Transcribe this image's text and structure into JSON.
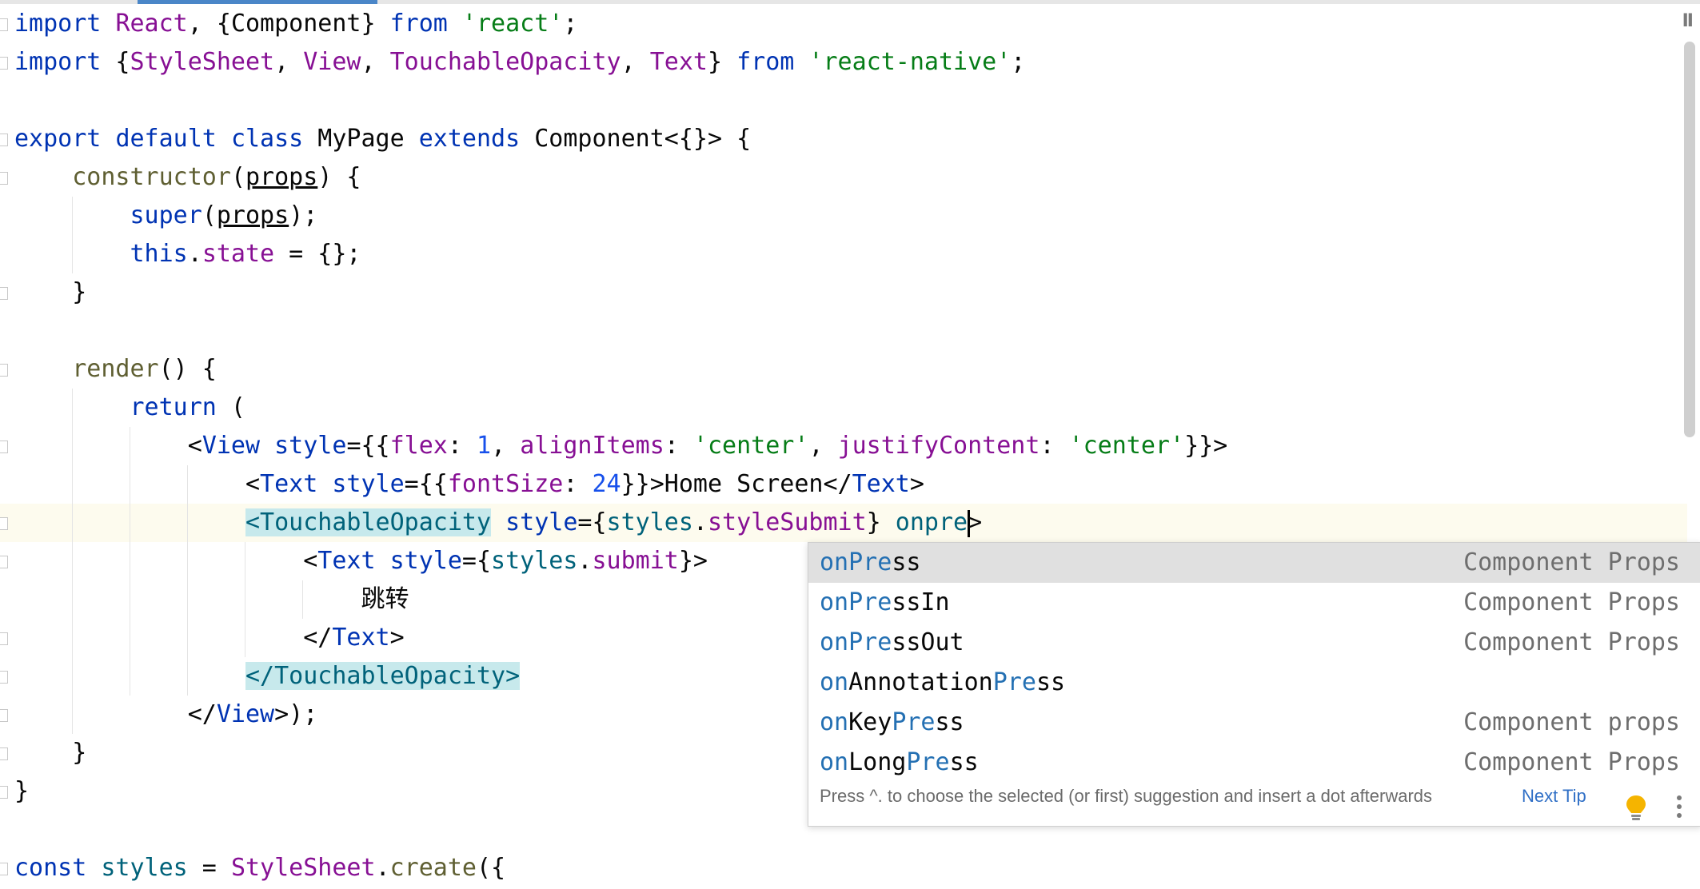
{
  "editor": {
    "lines": [
      {
        "tokens": [
          {
            "t": "import",
            "c": "kw"
          },
          {
            "t": " "
          },
          {
            "t": "React",
            "c": "prop"
          },
          {
            "t": ", {"
          },
          {
            "t": "Component"
          },
          {
            "t": "} "
          },
          {
            "t": "from",
            "c": "kw"
          },
          {
            "t": " "
          },
          {
            "t": "'react'",
            "c": "str"
          },
          {
            "t": ";"
          }
        ]
      },
      {
        "tokens": [
          {
            "t": "import",
            "c": "kw"
          },
          {
            "t": " {"
          },
          {
            "t": "StyleSheet",
            "c": "prop"
          },
          {
            "t": ", "
          },
          {
            "t": "View",
            "c": "prop"
          },
          {
            "t": ", "
          },
          {
            "t": "TouchableOpacity",
            "c": "prop"
          },
          {
            "t": ", "
          },
          {
            "t": "Text",
            "c": "prop"
          },
          {
            "t": "} "
          },
          {
            "t": "from",
            "c": "kw"
          },
          {
            "t": " "
          },
          {
            "t": "'react-native'",
            "c": "str"
          },
          {
            "t": ";"
          }
        ]
      },
      {
        "tokens": []
      },
      {
        "tokens": [
          {
            "t": "export",
            "c": "kw"
          },
          {
            "t": " "
          },
          {
            "t": "default",
            "c": "kw"
          },
          {
            "t": " "
          },
          {
            "t": "class",
            "c": "kw"
          },
          {
            "t": " MyPage "
          },
          {
            "t": "extends",
            "c": "kw"
          },
          {
            "t": " Component<{}> {"
          }
        ]
      },
      {
        "tokens": [
          {
            "t": "    "
          },
          {
            "t": "constructor",
            "c": "meth"
          },
          {
            "t": "("
          },
          {
            "t": "props",
            "c": "u"
          },
          {
            "t": ") {"
          }
        ]
      },
      {
        "tokens": [
          {
            "t": "        "
          },
          {
            "t": "super",
            "c": "kw"
          },
          {
            "t": "("
          },
          {
            "t": "props",
            "c": "u"
          },
          {
            "t": ");"
          }
        ]
      },
      {
        "tokens": [
          {
            "t": "        "
          },
          {
            "t": "this",
            "c": "kw"
          },
          {
            "t": "."
          },
          {
            "t": "state",
            "c": "prop"
          },
          {
            "t": " = {};"
          }
        ]
      },
      {
        "tokens": [
          {
            "t": "    }"
          }
        ]
      },
      {
        "tokens": []
      },
      {
        "tokens": [
          {
            "t": "    "
          },
          {
            "t": "render",
            "c": "meth"
          },
          {
            "t": "() {"
          }
        ]
      },
      {
        "tokens": [
          {
            "t": "        "
          },
          {
            "t": "return",
            "c": "kw"
          },
          {
            "t": " ("
          }
        ]
      },
      {
        "tokens": [
          {
            "t": "            <"
          },
          {
            "t": "View",
            "c": "tag"
          },
          {
            "t": " "
          },
          {
            "t": "style",
            "c": "tag"
          },
          {
            "t": "={{"
          },
          {
            "t": "flex",
            "c": "prop"
          },
          {
            "t": ": "
          },
          {
            "t": "1",
            "c": "num"
          },
          {
            "t": ", "
          },
          {
            "t": "alignItems",
            "c": "prop"
          },
          {
            "t": ": "
          },
          {
            "t": "'center'",
            "c": "str"
          },
          {
            "t": ", "
          },
          {
            "t": "justifyContent",
            "c": "prop"
          },
          {
            "t": ": "
          },
          {
            "t": "'center'",
            "c": "str"
          },
          {
            "t": "}}>"
          }
        ]
      },
      {
        "tokens": [
          {
            "t": "                <"
          },
          {
            "t": "Text",
            "c": "tag"
          },
          {
            "t": " "
          },
          {
            "t": "style",
            "c": "tag"
          },
          {
            "t": "={{"
          },
          {
            "t": "fontSize",
            "c": "prop"
          },
          {
            "t": ": "
          },
          {
            "t": "24",
            "c": "num"
          },
          {
            "t": "}}>Home Screen</"
          },
          {
            "t": "Text",
            "c": "tag"
          },
          {
            "t": ">"
          }
        ]
      },
      {
        "current": true,
        "tokens": [
          {
            "t": "                "
          },
          {
            "t": "<TouchableOpacity",
            "c": "comp hl"
          },
          {
            "t": " "
          },
          {
            "t": "style",
            "c": "tag"
          },
          {
            "t": "={"
          },
          {
            "t": "styles",
            "c": "comp"
          },
          {
            "t": "."
          },
          {
            "t": "styleSubmit",
            "c": "prop"
          },
          {
            "t": "} "
          },
          {
            "t": "onpre",
            "c": "comp"
          },
          {
            "cursor": true
          },
          {
            "t": ">"
          }
        ]
      },
      {
        "tokens": [
          {
            "t": "                    <"
          },
          {
            "t": "Text",
            "c": "tag"
          },
          {
            "t": " "
          },
          {
            "t": "style",
            "c": "tag"
          },
          {
            "t": "={"
          },
          {
            "t": "styles",
            "c": "comp"
          },
          {
            "t": "."
          },
          {
            "t": "submit",
            "c": "prop"
          },
          {
            "t": "}>"
          }
        ]
      },
      {
        "tokens": [
          {
            "t": "                        跳转"
          }
        ]
      },
      {
        "tokens": [
          {
            "t": "                    </"
          },
          {
            "t": "Text",
            "c": "tag"
          },
          {
            "t": ">"
          }
        ]
      },
      {
        "tokens": [
          {
            "t": "                "
          },
          {
            "t": "</TouchableOpacity>",
            "c": "comp hl"
          }
        ]
      },
      {
        "tokens": [
          {
            "t": "            </"
          },
          {
            "t": "View",
            "c": "tag"
          },
          {
            "t": ">);"
          }
        ]
      },
      {
        "tokens": [
          {
            "t": "    }"
          }
        ]
      },
      {
        "tokens": [
          {
            "t": "}"
          }
        ]
      },
      {
        "tokens": []
      },
      {
        "tokens": [
          {
            "t": "const",
            "c": "kw"
          },
          {
            "t": " "
          },
          {
            "t": "styles",
            "c": "comp"
          },
          {
            "t": " = "
          },
          {
            "t": "StyleSheet",
            "c": "prop"
          },
          {
            "t": "."
          },
          {
            "t": "create",
            "c": "meth"
          },
          {
            "t": "({"
          }
        ]
      }
    ]
  },
  "completion": {
    "items": [
      {
        "parts": [
          {
            "t": "onPre",
            "m": true
          },
          {
            "t": "ss"
          }
        ],
        "type": "Component Props",
        "selected": true
      },
      {
        "parts": [
          {
            "t": "onPre",
            "m": true
          },
          {
            "t": "ssIn"
          }
        ],
        "type": "Component Props"
      },
      {
        "parts": [
          {
            "t": "onPre",
            "m": true
          },
          {
            "t": "ssOut"
          }
        ],
        "type": "Component Props"
      },
      {
        "parts": [
          {
            "t": "on",
            "m": true
          },
          {
            "t": "Annotation"
          },
          {
            "t": "Pre",
            "m": true
          },
          {
            "t": "ss"
          }
        ],
        "type": ""
      },
      {
        "parts": [
          {
            "t": "on",
            "m": true
          },
          {
            "t": "Key"
          },
          {
            "t": "Pre",
            "m": true
          },
          {
            "t": "ss"
          }
        ],
        "type": "Component props"
      },
      {
        "parts": [
          {
            "t": "on",
            "m": true
          },
          {
            "t": "Long"
          },
          {
            "t": "Pre",
            "m": true
          },
          {
            "t": "ss"
          }
        ],
        "type": "Component Props"
      }
    ],
    "hint": "Press ^. to choose the selected (or first) suggestion and insert a dot afterwards",
    "next_tip": "Next Tip",
    "bulb_icon": "lightbulb-icon",
    "more_icon": "more-vertical-icon"
  }
}
